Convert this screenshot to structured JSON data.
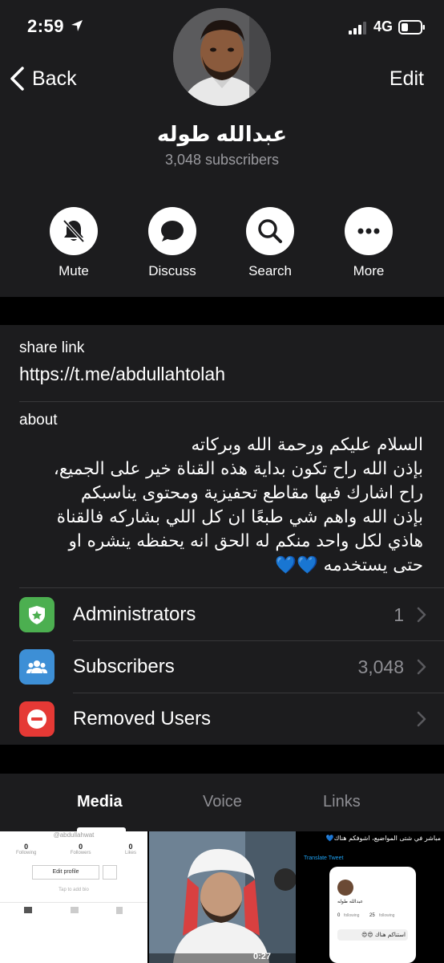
{
  "status_bar": {
    "time": "2:59",
    "network": "4G"
  },
  "nav": {
    "back_label": "Back",
    "edit_label": "Edit"
  },
  "channel": {
    "name": "عبدالله طوله",
    "subscribers_text": "3,048 subscribers"
  },
  "actions": [
    {
      "label": "Mute",
      "icon": "bell-slash-icon"
    },
    {
      "label": "Discuss",
      "icon": "chat-bubble-icon"
    },
    {
      "label": "Search",
      "icon": "search-icon"
    },
    {
      "label": "More",
      "icon": "more-dots-icon"
    }
  ],
  "info": {
    "share_link_label": "share link",
    "share_link_value": "https://t.me/abdullahtolah",
    "about_label": "about",
    "about_lines": [
      "السلام عليكم ورحمة الله وبركاته",
      "بإذن الله راح تكون بداية هذه القناة خير على الجميع،",
      "راح اشارك فيها مقاطع تحفيزية ومحتوى يناسبكم",
      "بإذن الله واهم شي طبعًا ان كل اللي بشاركه فالقناة",
      "هاذي لكل واحد منكم له الحق انه يحفظه ينشره او",
      "حتى يستخدمه 💙💙"
    ]
  },
  "rows": [
    {
      "label": "Administrators",
      "value": "1",
      "icon": "admin-badge-icon",
      "color": "#4caf50"
    },
    {
      "label": "Subscribers",
      "value": "3,048",
      "icon": "people-icon",
      "color": "#3d8fd6"
    },
    {
      "label": "Removed Users",
      "value": "",
      "icon": "minus-circle-icon",
      "color": "#e53935"
    }
  ],
  "tabs": [
    {
      "label": "Media",
      "active": true
    },
    {
      "label": "Voice",
      "active": false
    },
    {
      "label": "Links",
      "active": false
    }
  ],
  "media": {
    "thumb1": {
      "username": "@abdullahwat",
      "stats": [
        {
          "num": "0",
          "label": "Following"
        },
        {
          "num": "0",
          "label": "Followers"
        },
        {
          "num": "0",
          "label": "Likes"
        }
      ],
      "edit_profile": "Edit profile",
      "bio_hint": "Tap to add bio"
    },
    "thumb2": {
      "duration": "0:27"
    },
    "thumb3": {
      "tweet_line1": "مباشر في شتى المواضيع، اشوفكم هناك💙",
      "translate": "Translate Tweet",
      "profile_name": "عبدالله طوله",
      "following_count": "0",
      "followers_count": "25",
      "following_label": "following",
      "followers_label": "following",
      "caption": "استناكم هناك 😍😍"
    }
  },
  "colors": {
    "background": "#1c1c1e",
    "separator_band": "#000000",
    "secondary_text": "#8e8e93"
  }
}
